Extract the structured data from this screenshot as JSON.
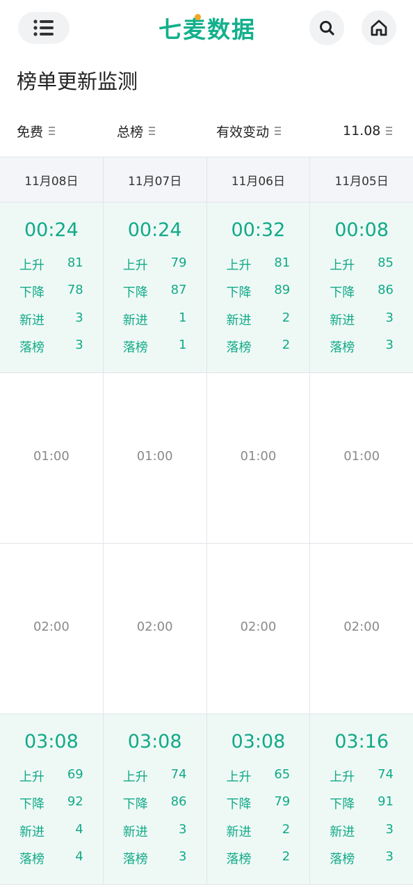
{
  "header": {
    "logo_text": "七麦数据",
    "colors": {
      "brand": "#13b08c",
      "accent": "#f5a623"
    },
    "icons": {
      "menu": "menu-list-icon",
      "search": "search-icon",
      "home": "home-icon"
    }
  },
  "page_title": "榜单更新监测",
  "filters": [
    {
      "label": "免费"
    },
    {
      "label": "总榜"
    },
    {
      "label": "有效变动"
    },
    {
      "label": "11.08"
    }
  ],
  "columns": [
    "11月08日",
    "11月07日",
    "11月06日",
    "11月05日"
  ],
  "stat_labels": {
    "up": "上升",
    "down": "下降",
    "new": "新进",
    "drop": "落榜"
  },
  "rows": [
    {
      "cells": [
        {
          "time": "00:24",
          "up": "81",
          "down": "78",
          "new": "3",
          "drop": "3"
        },
        {
          "time": "00:24",
          "up": "79",
          "down": "87",
          "new": "1",
          "drop": "1"
        },
        {
          "time": "00:32",
          "up": "81",
          "down": "89",
          "new": "2",
          "drop": "2"
        },
        {
          "time": "00:08",
          "up": "85",
          "down": "86",
          "new": "3",
          "drop": "3"
        }
      ]
    },
    {
      "cells": [
        {
          "empty": "01:00"
        },
        {
          "empty": "01:00"
        },
        {
          "empty": "01:00"
        },
        {
          "empty": "01:00"
        }
      ]
    },
    {
      "cells": [
        {
          "empty": "02:00"
        },
        {
          "empty": "02:00"
        },
        {
          "empty": "02:00"
        },
        {
          "empty": "02:00"
        }
      ]
    },
    {
      "cells": [
        {
          "time": "03:08",
          "up": "69",
          "down": "92",
          "new": "4",
          "drop": "4"
        },
        {
          "time": "03:08",
          "up": "74",
          "down": "86",
          "new": "3",
          "drop": "3"
        },
        {
          "time": "03:08",
          "up": "65",
          "down": "79",
          "new": "2",
          "drop": "2"
        },
        {
          "time": "03:16",
          "up": "74",
          "down": "91",
          "new": "3",
          "drop": "3"
        }
      ]
    }
  ]
}
